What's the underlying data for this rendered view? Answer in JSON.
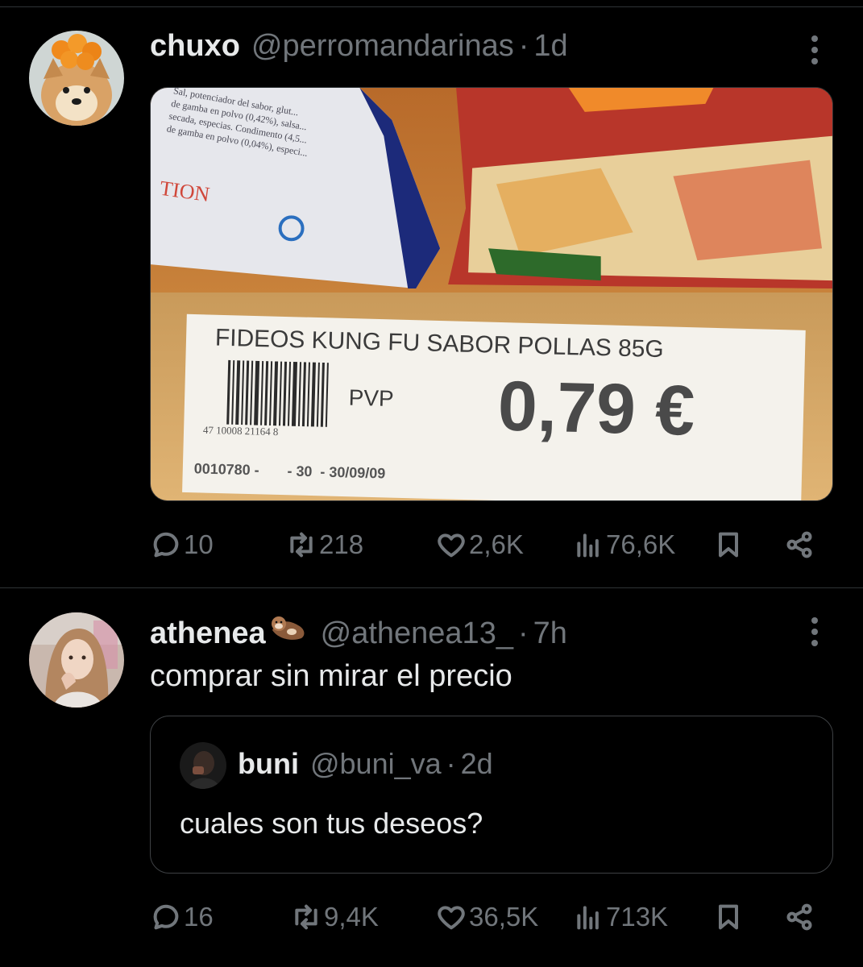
{
  "tweet1": {
    "name": "chuxo",
    "handle": "@perromandarinas",
    "separator": "·",
    "time": "1d",
    "image": {
      "product_line": "FIDEOS KUNG FU SABOR POLLAS 85G",
      "pvp": "PVP",
      "price": "0,79 €",
      "barcode_number": "47  10008 21164  8",
      "footer_code": "0010780 -       - 30  - 30/09/09",
      "package_text": "TION"
    },
    "actions": {
      "replies": "10",
      "retweets": "218",
      "likes": "2,6K",
      "views": "76,6K"
    }
  },
  "tweet2": {
    "name": "athenea",
    "name_emoji": "otter",
    "handle": "@athenea13_",
    "separator": "·",
    "time": "7h",
    "text": "comprar sin mirar el precio",
    "quote": {
      "name": "buni",
      "handle": "@buni_va",
      "separator": "·",
      "time": "2d",
      "text": "cuales son tus deseos?"
    },
    "actions": {
      "replies": "16",
      "retweets": "9,4K",
      "likes": "36,5K",
      "views": "713K"
    }
  },
  "colors": {
    "background": "#000000",
    "text_primary": "#e7e9ea",
    "text_secondary": "#71767b",
    "border": "#2f3336"
  },
  "icons": {
    "reply": "reply-icon",
    "retweet": "retweet-icon",
    "like": "heart-icon",
    "views": "views-chart-icon",
    "bookmark": "bookmark-icon",
    "share": "share-icon",
    "more": "more-dots-icon"
  }
}
